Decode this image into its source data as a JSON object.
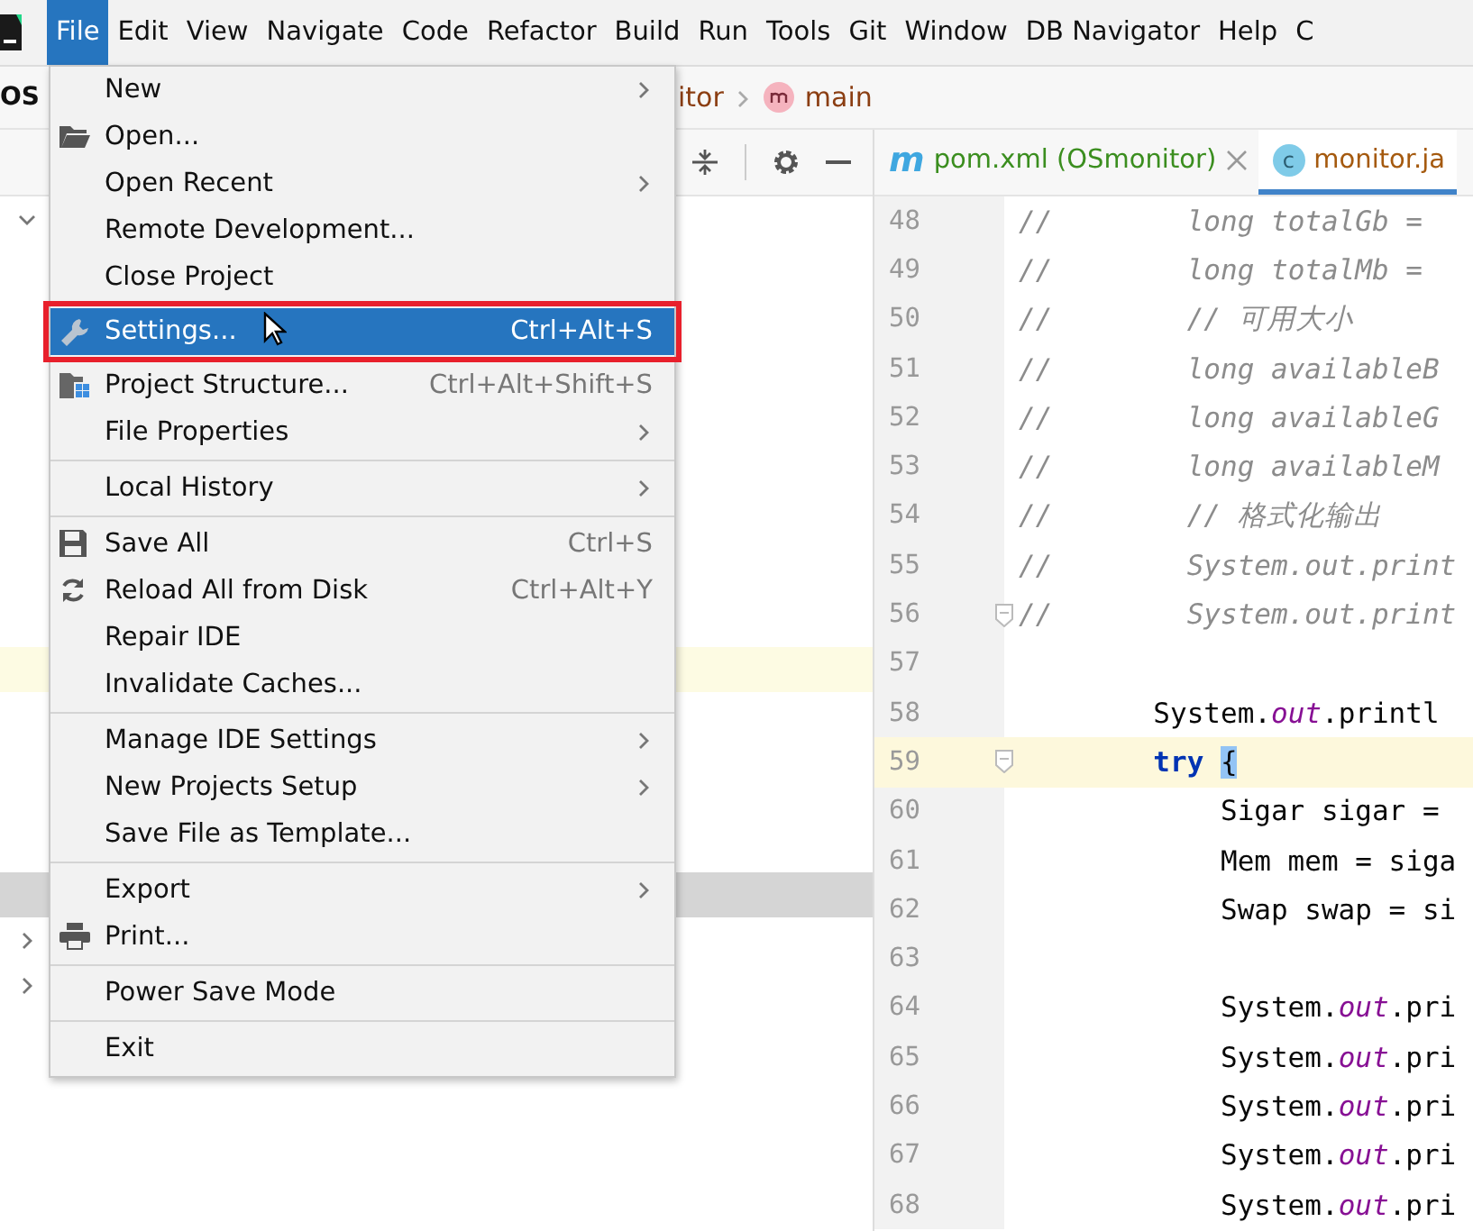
{
  "menu_bar": {
    "items": [
      {
        "label": "File",
        "selected": true
      },
      {
        "label": "Edit",
        "selected": false
      },
      {
        "label": "View",
        "selected": false
      },
      {
        "label": "Navigate",
        "selected": false
      },
      {
        "label": "Code",
        "selected": false
      },
      {
        "label": "Refactor",
        "selected": false
      },
      {
        "label": "Build",
        "selected": false
      },
      {
        "label": "Run",
        "selected": false
      },
      {
        "label": "Tools",
        "selected": false
      },
      {
        "label": "Git",
        "selected": false
      },
      {
        "label": "Window",
        "selected": false
      },
      {
        "label": "DB Navigator",
        "selected": false
      },
      {
        "label": "Help",
        "selected": false
      },
      {
        "label": "C",
        "selected": false
      }
    ]
  },
  "project_name": "OS",
  "breadcrumb": {
    "items": [
      "itor",
      "main"
    ]
  },
  "project_tree": {
    "rows": [
      {
        "expanded": true,
        "selected": false,
        "current": false
      },
      {
        "selected": false,
        "current": false
      },
      {
        "selected": false,
        "current": false
      },
      {
        "selected": false,
        "current": false
      },
      {
        "selected": false,
        "current": false
      },
      {
        "selected": false,
        "current": false
      },
      {
        "selected": false,
        "current": false
      },
      {
        "selected": false,
        "current": false
      },
      {
        "selected": false,
        "current": false
      },
      {
        "selected": false,
        "current": false
      },
      {
        "selected": false,
        "current": true
      },
      {
        "selected": false,
        "current": false
      },
      {
        "selected": false,
        "current": false
      },
      {
        "selected": false,
        "current": false
      },
      {
        "selected": false,
        "current": false
      },
      {
        "selected": true,
        "current": false
      },
      {
        "expanded": false,
        "selected": false,
        "current": false
      },
      {
        "expanded": false,
        "selected": false,
        "current": false
      }
    ]
  },
  "editor_tabs": [
    {
      "label": "pom.xml (OSmonitor)",
      "icon_letter": "m",
      "kind": "maven",
      "selected": false,
      "closable": true
    },
    {
      "label": "monitor.ja",
      "icon_letter": "c",
      "kind": "class",
      "selected": true,
      "closable": false
    }
  ],
  "code_lines": [
    {
      "number": "48",
      "marker": "//",
      "current": false,
      "fold": false,
      "tokens": [
        {
          "text": "        long totalGb =",
          "kind": "commented"
        }
      ]
    },
    {
      "number": "49",
      "marker": "//",
      "current": false,
      "fold": false,
      "tokens": [
        {
          "text": "        long totalMb =",
          "kind": "commented"
        }
      ]
    },
    {
      "number": "50",
      "marker": "//",
      "current": false,
      "fold": false,
      "tokens": [
        {
          "text": "        // 可用大小",
          "kind": "commented"
        }
      ]
    },
    {
      "number": "51",
      "marker": "//",
      "current": false,
      "fold": false,
      "tokens": [
        {
          "text": "        long availableB",
          "kind": "commented"
        }
      ]
    },
    {
      "number": "52",
      "marker": "//",
      "current": false,
      "fold": false,
      "tokens": [
        {
          "text": "        long availableG",
          "kind": "commented"
        }
      ]
    },
    {
      "number": "53",
      "marker": "//",
      "current": false,
      "fold": false,
      "tokens": [
        {
          "text": "        long availableM",
          "kind": "commented"
        }
      ]
    },
    {
      "number": "54",
      "marker": "//",
      "current": false,
      "fold": false,
      "tokens": [
        {
          "text": "        // 格式化输出",
          "kind": "commented"
        }
      ]
    },
    {
      "number": "55",
      "marker": "//",
      "current": false,
      "fold": false,
      "tokens": [
        {
          "text": "        System.out.print",
          "kind": "commented"
        }
      ]
    },
    {
      "number": "56",
      "marker": "//",
      "current": false,
      "fold": true,
      "tokens": [
        {
          "text": "        System.out.print",
          "kind": "commented"
        }
      ]
    },
    {
      "number": "57",
      "current": false,
      "fold": false
    },
    {
      "number": "58",
      "current": false,
      "fold": false,
      "tokens": [
        {
          "text": "        System.",
          "kind": "plain"
        },
        {
          "text": "out",
          "kind": "field"
        },
        {
          "text": ".printl",
          "kind": "plain"
        }
      ]
    },
    {
      "number": "59",
      "current": true,
      "fold": true,
      "tokens": [
        {
          "text": "        try ",
          "kind": "keyword"
        },
        {
          "text": "{",
          "kind": "brace-match"
        }
      ]
    },
    {
      "number": "60",
      "current": false,
      "fold": false,
      "tokens": [
        {
          "text": "            Sigar sigar =",
          "kind": "plain"
        }
      ]
    },
    {
      "number": "61",
      "current": false,
      "fold": false,
      "tokens": [
        {
          "text": "            Mem mem = siga",
          "kind": "plain"
        }
      ]
    },
    {
      "number": "62",
      "current": false,
      "fold": false,
      "tokens": [
        {
          "text": "            Swap swap = si",
          "kind": "plain"
        }
      ]
    },
    {
      "number": "63",
      "current": false,
      "fold": false
    },
    {
      "number": "64",
      "current": false,
      "fold": false,
      "tokens": [
        {
          "text": "            System.",
          "kind": "plain"
        },
        {
          "text": "out",
          "kind": "field"
        },
        {
          "text": ".pri",
          "kind": "plain"
        }
      ]
    },
    {
      "number": "65",
      "current": false,
      "fold": false,
      "tokens": [
        {
          "text": "            System.",
          "kind": "plain"
        },
        {
          "text": "out",
          "kind": "field"
        },
        {
          "text": ".pri",
          "kind": "plain"
        }
      ]
    },
    {
      "number": "66",
      "current": false,
      "fold": false,
      "tokens": [
        {
          "text": "            System.",
          "kind": "plain"
        },
        {
          "text": "out",
          "kind": "field"
        },
        {
          "text": ".pri",
          "kind": "plain"
        }
      ]
    },
    {
      "number": "67",
      "current": false,
      "fold": false,
      "tokens": [
        {
          "text": "            System.",
          "kind": "plain"
        },
        {
          "text": "out",
          "kind": "field"
        },
        {
          "text": ".pri",
          "kind": "plain"
        }
      ]
    },
    {
      "number": "68",
      "current": false,
      "fold": false,
      "tokens": [
        {
          "text": "            System.",
          "kind": "plain"
        },
        {
          "text": "out",
          "kind": "field"
        },
        {
          "text": ".pri",
          "kind": "plain"
        }
      ]
    }
  ],
  "file_menu": {
    "items": [
      {
        "kind": "item",
        "label": "New",
        "submenu": true,
        "selected": false
      },
      {
        "kind": "item",
        "label": "Open...",
        "submenu": false,
        "selected": false
      },
      {
        "kind": "item",
        "label": "Open Recent",
        "submenu": true,
        "selected": false
      },
      {
        "kind": "item",
        "label": "Remote Development...",
        "submenu": false,
        "selected": false
      },
      {
        "kind": "item",
        "label": "Close Project",
        "submenu": false,
        "selected": false
      },
      {
        "kind": "item",
        "label": "Settings...",
        "shortcut": "Ctrl+Alt+S",
        "submenu": false,
        "selected": true,
        "annotated": true
      },
      {
        "kind": "item",
        "label": "Project Structure...",
        "shortcut": "Ctrl+Alt+Shift+S",
        "submenu": false,
        "selected": false
      },
      {
        "kind": "item",
        "label": "File Properties",
        "submenu": true,
        "selected": false
      },
      {
        "kind": "separator"
      },
      {
        "kind": "item",
        "label": "Local History",
        "submenu": true,
        "selected": false
      },
      {
        "kind": "separator"
      },
      {
        "kind": "item",
        "label": "Save All",
        "shortcut": "Ctrl+S",
        "submenu": false,
        "selected": false
      },
      {
        "kind": "item",
        "label": "Reload All from Disk",
        "shortcut": "Ctrl+Alt+Y",
        "submenu": false,
        "selected": false
      },
      {
        "kind": "item",
        "label": "Repair IDE",
        "submenu": false,
        "selected": false
      },
      {
        "kind": "item",
        "label": "Invalidate Caches...",
        "submenu": false,
        "selected": false
      },
      {
        "kind": "separator"
      },
      {
        "kind": "item",
        "label": "Manage IDE Settings",
        "submenu": true,
        "selected": false
      },
      {
        "kind": "item",
        "label": "New Projects Setup",
        "submenu": true,
        "selected": false
      },
      {
        "kind": "item",
        "label": "Save File as Template...",
        "submenu": false,
        "selected": false
      },
      {
        "kind": "separator"
      },
      {
        "kind": "item",
        "label": "Export",
        "submenu": true,
        "selected": false
      },
      {
        "kind": "item",
        "label": "Print...",
        "submenu": false,
        "selected": false
      },
      {
        "kind": "separator"
      },
      {
        "kind": "item",
        "label": "Power Save Mode",
        "submenu": false,
        "selected": false
      },
      {
        "kind": "separator"
      },
      {
        "kind": "item",
        "label": "Exit",
        "submenu": false,
        "selected": false
      }
    ]
  }
}
